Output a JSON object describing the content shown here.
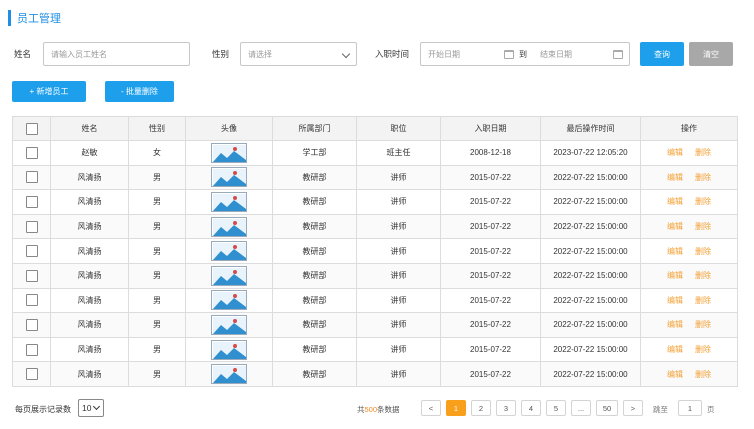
{
  "page_title": "员工管理",
  "filters": {
    "name_label": "姓名",
    "name_placeholder": "请输入员工姓名",
    "gender_label": "性别",
    "gender_placeholder": "请选择",
    "entry_label": "入职时间",
    "start_placeholder": "开始日期",
    "to_label": "到",
    "end_placeholder": "结束日期",
    "query_btn": "查询",
    "clear_btn": "清空"
  },
  "actions": {
    "add_btn": "+ 新增员工",
    "batch_delete_btn": "- 批量删除"
  },
  "table": {
    "headers": [
      "姓名",
      "性别",
      "头像",
      "所属部门",
      "职位",
      "入职日期",
      "最后操作时间",
      "操作"
    ],
    "edit_label": "编辑",
    "delete_label": "删除",
    "rows": [
      {
        "name": "赵敏",
        "gender": "女",
        "dept": "学工部",
        "position": "班主任",
        "entry_date": "2008-12-18",
        "last_op": "2023-07-22 12:05:20"
      },
      {
        "name": "风清扬",
        "gender": "男",
        "dept": "教研部",
        "position": "讲师",
        "entry_date": "2015-07-22",
        "last_op": "2022-07-22 15:00:00"
      },
      {
        "name": "风清扬",
        "gender": "男",
        "dept": "教研部",
        "position": "讲师",
        "entry_date": "2015-07-22",
        "last_op": "2022-07-22 15:00:00"
      },
      {
        "name": "风清扬",
        "gender": "男",
        "dept": "教研部",
        "position": "讲师",
        "entry_date": "2015-07-22",
        "last_op": "2022-07-22 15:00:00"
      },
      {
        "name": "风清扬",
        "gender": "男",
        "dept": "教研部",
        "position": "讲师",
        "entry_date": "2015-07-22",
        "last_op": "2022-07-22 15:00:00"
      },
      {
        "name": "风清扬",
        "gender": "男",
        "dept": "教研部",
        "position": "讲师",
        "entry_date": "2015-07-22",
        "last_op": "2022-07-22 15:00:00"
      },
      {
        "name": "风清扬",
        "gender": "男",
        "dept": "教研部",
        "position": "讲师",
        "entry_date": "2015-07-22",
        "last_op": "2022-07-22 15:00:00"
      },
      {
        "name": "风清扬",
        "gender": "男",
        "dept": "教研部",
        "position": "讲师",
        "entry_date": "2015-07-22",
        "last_op": "2022-07-22 15:00:00"
      },
      {
        "name": "风清扬",
        "gender": "男",
        "dept": "教研部",
        "position": "讲师",
        "entry_date": "2015-07-22",
        "last_op": "2022-07-22 15:00:00"
      },
      {
        "name": "风清扬",
        "gender": "男",
        "dept": "教研部",
        "position": "讲师",
        "entry_date": "2015-07-22",
        "last_op": "2022-07-22 15:00:00"
      }
    ]
  },
  "pagination": {
    "page_size_label": "每页展示记录数",
    "page_size": "10",
    "total_prefix": "共",
    "total_count": "500",
    "total_suffix": "条数据",
    "prev": "<",
    "pages": [
      "1",
      "2",
      "3",
      "4",
      "5",
      "...",
      "50"
    ],
    "active_page": "1",
    "next": ">",
    "jump_label": "跳至",
    "jump_value": "1",
    "page_unit": "页"
  },
  "colors": {
    "primary": "#1e9fec",
    "accent_orange": "#f8a01b",
    "clear_gray": "#a8a8a8"
  }
}
